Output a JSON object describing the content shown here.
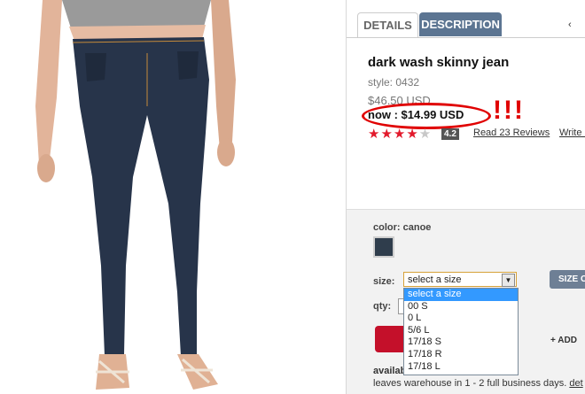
{
  "tabs": [
    {
      "label": "DETAILS"
    },
    {
      "label": "DESCRIPTION"
    }
  ],
  "close_glyph": "‹",
  "product": {
    "title": "dark wash skinny jean",
    "style": "style: 0432",
    "old_price": "$46.50 USD",
    "now_price": "now : $14.99 USD",
    "annotation": "!!!",
    "stars_filled": "★★★★",
    "stars_empty": "★",
    "rating": "4.2",
    "reviews_text": "Read 23 Reviews",
    "write_text": "Write a"
  },
  "options": {
    "color_label": "color: canoe",
    "swatch_color": "#2f3d4c",
    "size_label": "size:",
    "size_selected": "select a size",
    "size_chart": "SIZE C",
    "size_options": [
      "select a size",
      "00 S",
      "0 L",
      "5/6 L",
      "17/18 S",
      "17/18 R",
      "17/18 L"
    ],
    "qty_label": "qty:",
    "add_to_list": "+ ADD",
    "availability_label": "availab",
    "shipping_note": "leaves warehouse in 1 - 2 full business days.",
    "details_link": "det"
  }
}
